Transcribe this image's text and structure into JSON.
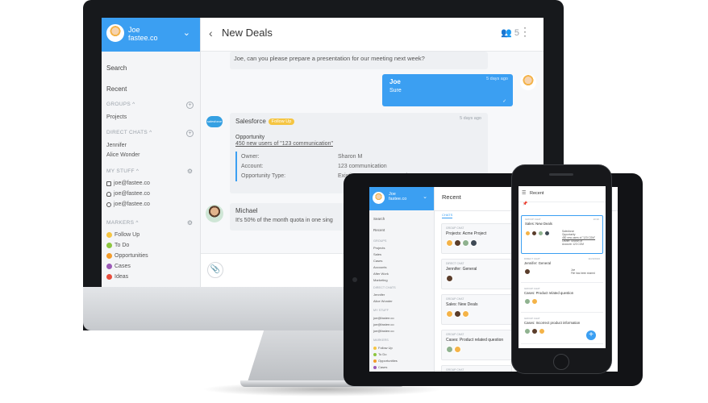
{
  "desktop": {
    "user": {
      "name": "Joe",
      "org": "fastee.co"
    },
    "sidebar": {
      "search": "Search",
      "recent": "Recent",
      "groups_label": "GROUPS",
      "projects": "Projects",
      "direct_label": "DIRECT CHATS",
      "contacts": [
        "Jennifer",
        "Alice Wonder"
      ],
      "mystuff_label": "MY STUFF",
      "emails": [
        "joe@fastee.co",
        "joe@fastee.co",
        "joe@fastee.co"
      ],
      "markers_label": "MARKERS",
      "markers": [
        {
          "label": "Follow Up",
          "color": "#f5c542"
        },
        {
          "label": "To Do",
          "color": "#8cc63f"
        },
        {
          "label": "Opportunities",
          "color": "#f39c2a"
        },
        {
          "label": "Cases",
          "color": "#9b59b6"
        },
        {
          "label": "Ideas",
          "color": "#e74c3c"
        }
      ]
    },
    "chat": {
      "title": "New Deals",
      "participants": "5",
      "messages": {
        "m1": "Joe, can you please prepare a presentation for our meeting next week?",
        "joe_name": "Joe",
        "joe_text": "Sure",
        "joe_time": "5 days ago",
        "sf_name": "Salesforce",
        "sf_badge": "Follow Up",
        "sf_time": "5 days ago",
        "sf_logo": "salesforce",
        "opp_title": "Opportunity",
        "opp_link": "450 new users of \"123 communication\"",
        "fields": [
          {
            "k": "Owner:",
            "v": "Sharon M"
          },
          {
            "k": "Account:",
            "v": "123 communication"
          },
          {
            "k": "Opportunity Type:",
            "v": "Existing Customer - Upgrade"
          }
        ],
        "michael_name": "Michael",
        "michael_text": "It's 50% of the month quota in one sing"
      }
    }
  },
  "tablet": {
    "user": {
      "name": "Joe",
      "org": "fastee.co"
    },
    "title": "Recent",
    "tab": "CHATS",
    "sidebar": {
      "search": "Search",
      "recent": "Recent",
      "groups_label": "GROUPS",
      "groups": [
        "Projects",
        "Sales",
        "Cases",
        "Accounts",
        "After Work",
        "Marketing"
      ],
      "direct_label": "DIRECT CHATS",
      "contacts": [
        "Jennifer",
        "Alice Wonder"
      ],
      "mystuff_label": "MY STUFF",
      "emails": [
        "joe@fastee.co",
        "joe@fastee.co",
        "joe@fastee.co"
      ],
      "markers_label": "MARKERS",
      "markers": [
        "Follow Up",
        "To Do",
        "Opportunities",
        "Cases"
      ]
    },
    "cards": [
      {
        "k": "GROUP CHAT",
        "v": "Projects: Acme Project"
      },
      {
        "k": "DIRECT CHAT",
        "v": "Jennifer: General"
      },
      {
        "k": "GROUP CHAT",
        "v": "Sales: New Deals"
      },
      {
        "k": "GROUP CHAT",
        "v": "Cases: Product related question"
      },
      {
        "k": "GROUP CHAT",
        "v": ""
      }
    ]
  },
  "phone": {
    "title": "Recent",
    "cards": [
      {
        "k": "GROUP CHAT",
        "v": "Sales: New Deals",
        "d": "10:30",
        "sf": "Salesforce",
        "sub": "Opportunity",
        "link": "450 new users of \"123 COM\"",
        "owner": "Owner: Sharon M",
        "account": "Account: 123 COM"
      },
      {
        "k": "DIRECT CHAT",
        "v": "Jennifer: General",
        "d": "11/23/2016",
        "sender": "Joe",
        "text": "File has been shared"
      },
      {
        "k": "GROUP CHAT",
        "v": "Cases: Product related question"
      },
      {
        "k": "GROUP CHAT",
        "v": "Cases: Incorrect product information"
      }
    ]
  }
}
